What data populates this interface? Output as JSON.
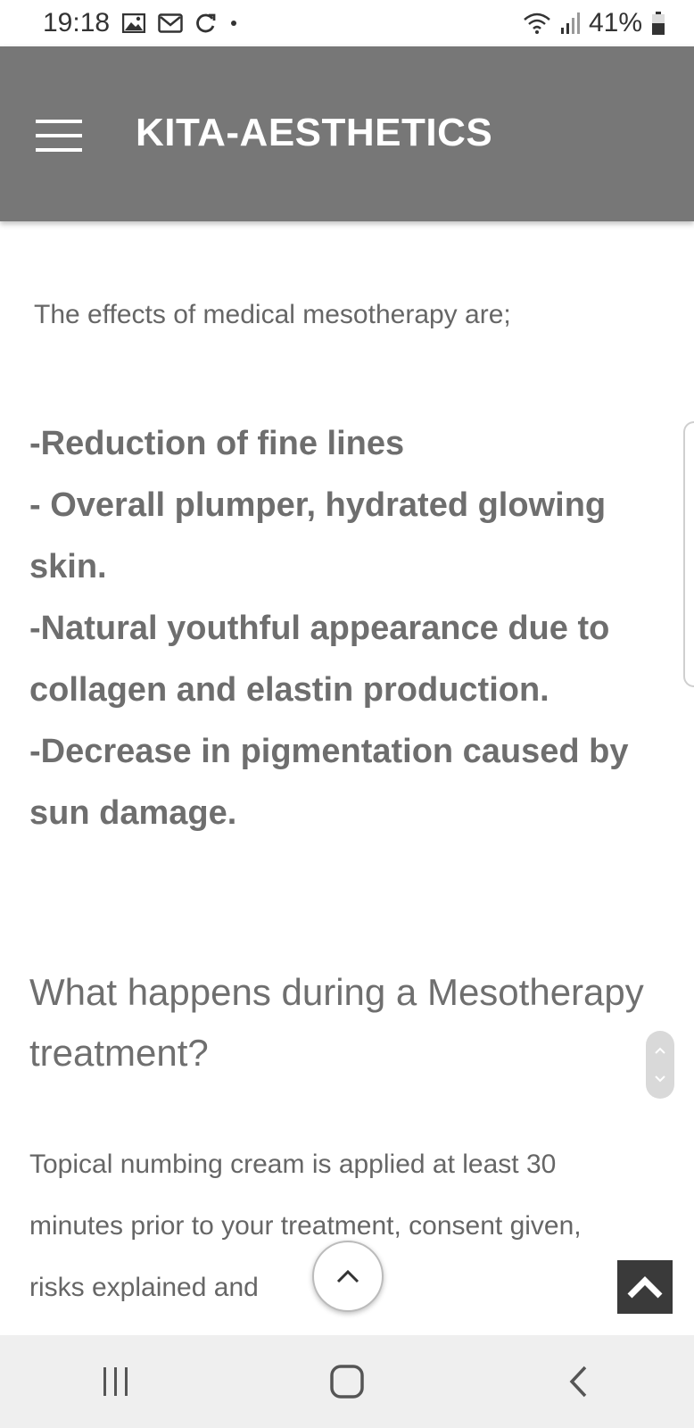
{
  "status_bar": {
    "time": "19:18",
    "battery_percent": "41%",
    "notification_icons": [
      "image-icon",
      "mail-icon",
      "sync-icon",
      "dot-icon"
    ],
    "right_icons": [
      "wifi-icon",
      "signal-icon",
      "battery-icon"
    ]
  },
  "app_bar": {
    "title": "KITA-AESTHETICS",
    "menu_icon": "hamburger-menu-icon"
  },
  "content": {
    "intro": "The effects of medical mesotherapy are;",
    "effects_lines": [
      "-Reduction of fine lines",
      "- Overall plumper, hydrated glowing",
      "skin.",
      "-Natural youthful appearance due to",
      "collagen and elastin production.",
      "-Decrease in pigmentation caused by",
      "sun damage."
    ],
    "heading_lines": [
      "What happens during a Mesotherapy",
      "treatment?"
    ],
    "body_lines": [
      "Topical numbing cream is applied at least 30",
      "minutes prior to your treatment, consent given,",
      "risks explained and"
    ]
  },
  "nav_bar": {
    "buttons": [
      "recent-apps-icon",
      "home-icon",
      "back-icon"
    ]
  },
  "colors": {
    "app_bar": "#777777",
    "text": "#6b6b6b",
    "nav_bar": "#efefef",
    "top_button": "#3a3a3a"
  }
}
